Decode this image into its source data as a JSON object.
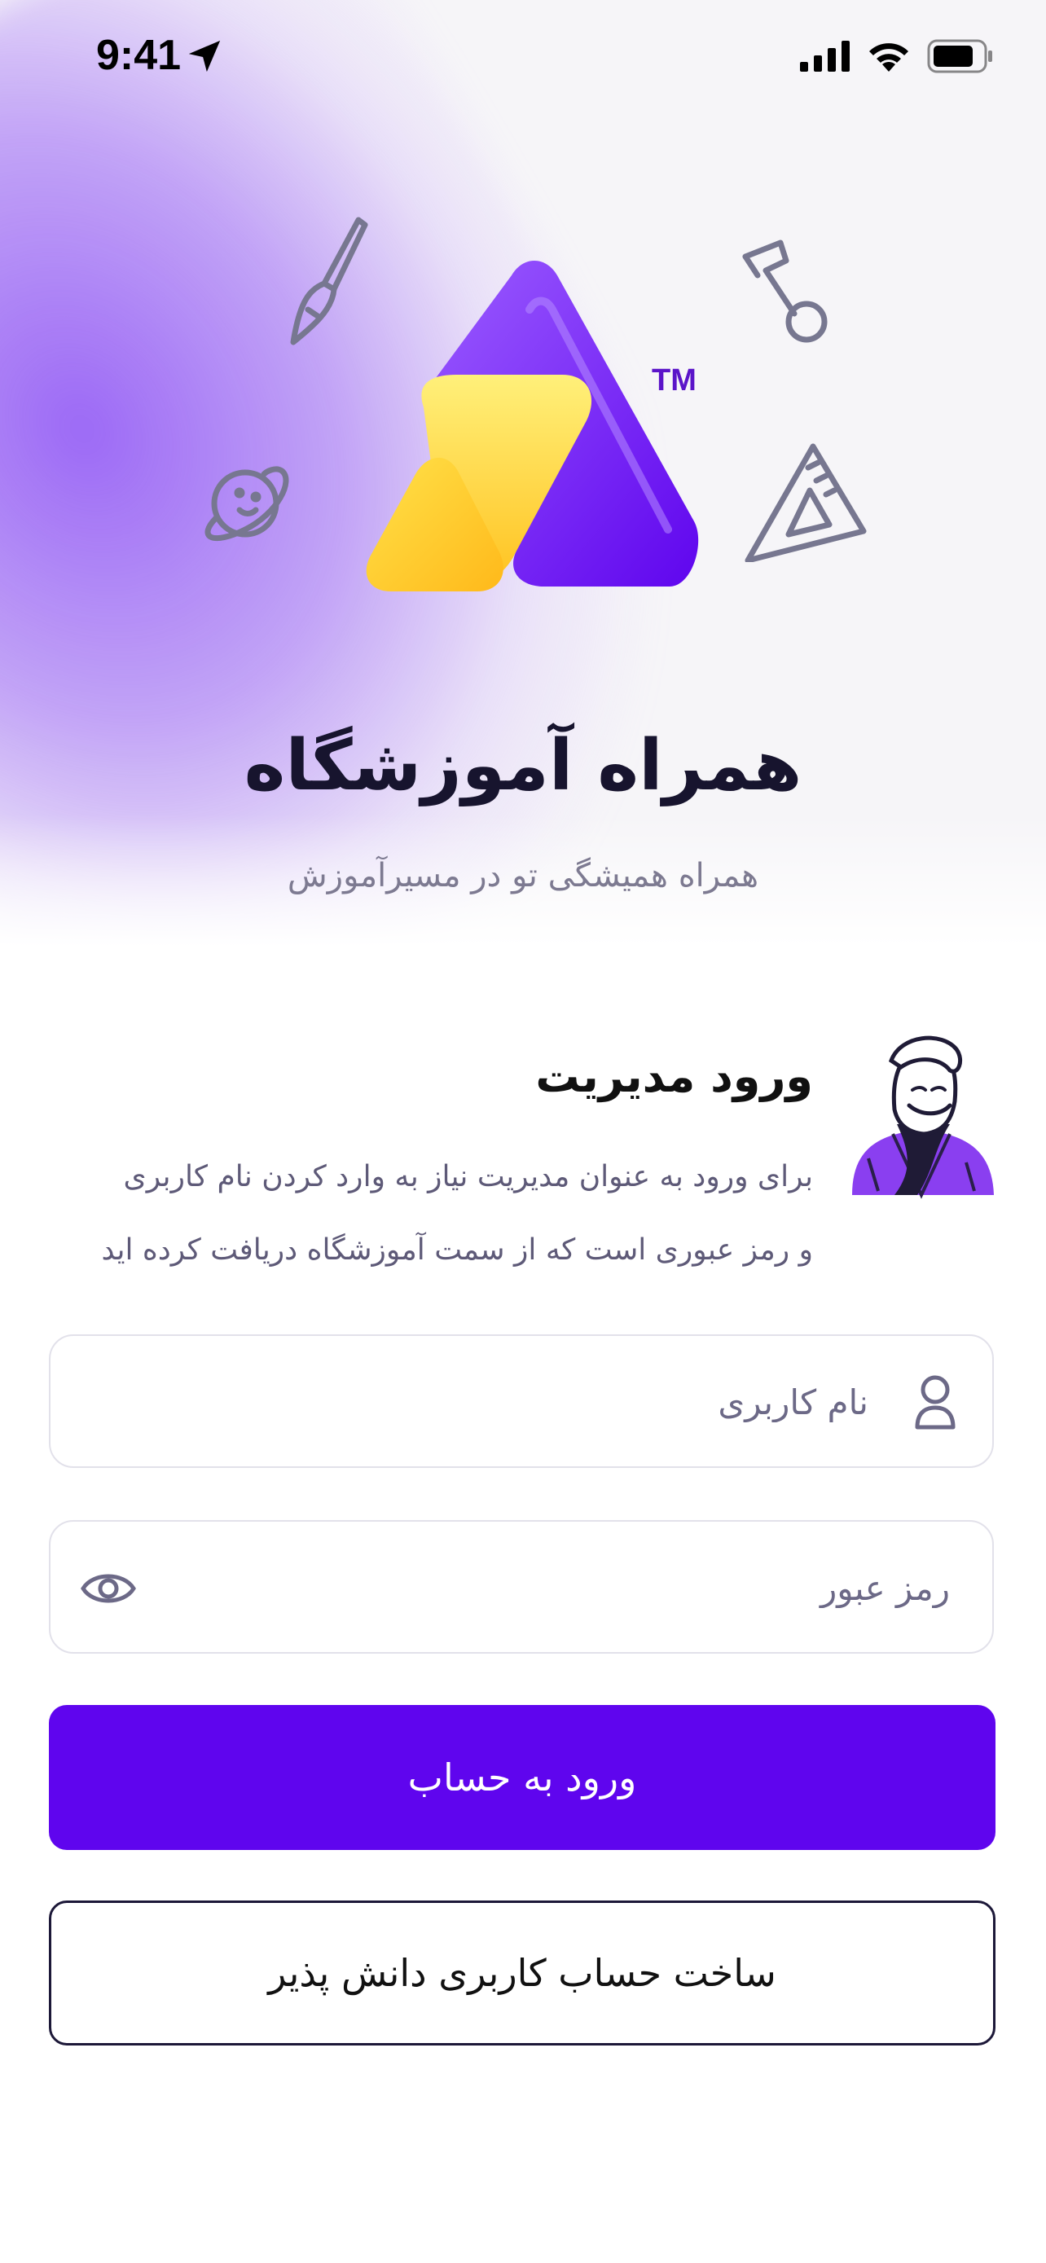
{
  "status_bar": {
    "time": "9:41"
  },
  "logo": {
    "trademark": "TM"
  },
  "app": {
    "title": "همراه آموزشگاه",
    "subtitle": "همراه همیشگی تو در مسیرآموزش"
  },
  "login": {
    "heading": "ورود مدیریت",
    "description_line1": "برای ورود به عنوان مدیریت نیاز به وارد کردن نام کاربری",
    "description_line2": "و رمز عبوری است که از سمت آموزشگاه دریافت کرده اید",
    "username_placeholder": "نام کاربری",
    "password_placeholder": "رمز عبور",
    "submit_label": "ورود به حساب",
    "register_label": "ساخت حساب کاربری دانش پذیر"
  },
  "colors": {
    "primary": "#5f05ee",
    "logo_purple": "#7b2ff0",
    "logo_yellow": "#ffd21f",
    "text_dark": "#17142e",
    "text_muted": "#7d7a91"
  },
  "icons": [
    "location-arrow-icon",
    "signal-icon",
    "wifi-icon",
    "battery-icon",
    "paintbrush-icon",
    "music-note-icon",
    "planet-icon",
    "set-square-icon",
    "user-icon",
    "eye-icon"
  ]
}
